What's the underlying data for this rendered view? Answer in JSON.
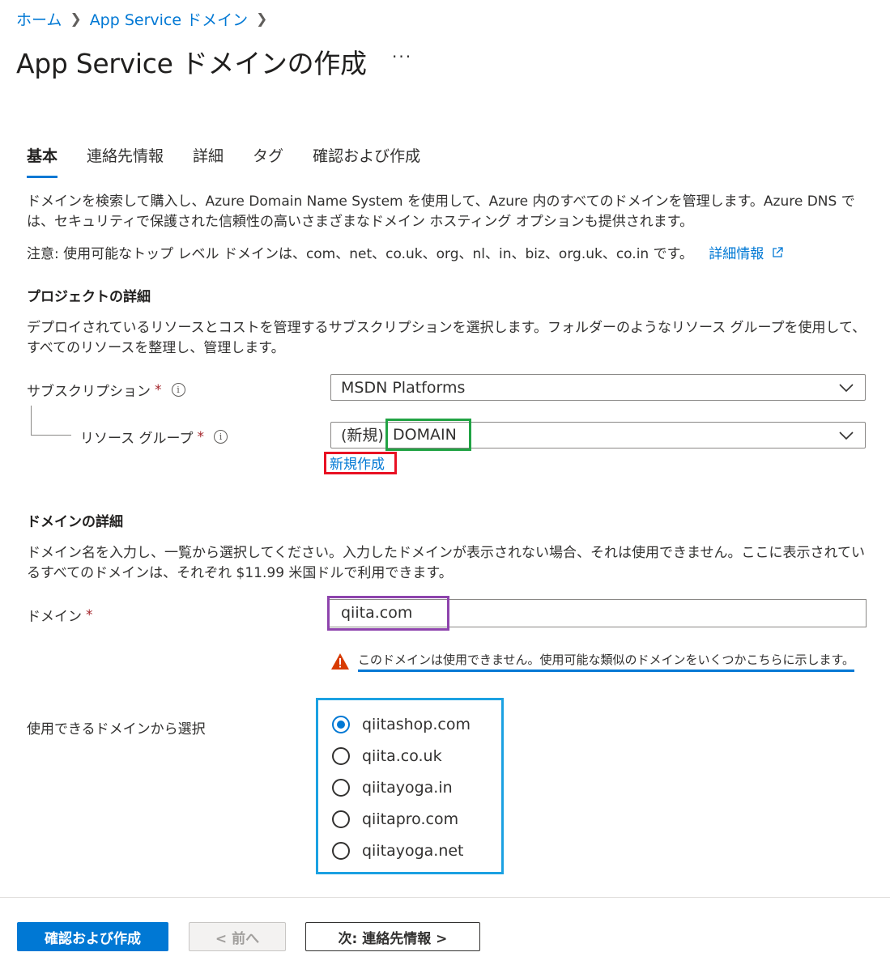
{
  "breadcrumb": {
    "home": "ホーム",
    "service": "App Service ドメイン"
  },
  "page": {
    "title": "App Service ドメインの作成",
    "more": "···"
  },
  "tabs": [
    {
      "label": "基本",
      "active": true
    },
    {
      "label": "連絡先情報"
    },
    {
      "label": "詳細"
    },
    {
      "label": "タグ"
    },
    {
      "label": "確認および作成"
    }
  ],
  "intro": {
    "description": "ドメインを検索して購入し、Azure Domain Name System を使用して、Azure 内のすべてのドメインを管理します。Azure DNS では、セキュリティで保護された信頼性の高いさまざまなドメイン ホスティング オプションも提供されます。",
    "note": "注意: 使用可能なトップ レベル ドメインは、com、net、co.uk、org、nl、in、biz、org.uk、co.in です。",
    "more_info_link": "詳細情報"
  },
  "project": {
    "heading": "プロジェクトの詳細",
    "description": "デプロイされているリソースとコストを管理するサブスクリプションを選択します。フォルダーのようなリソース グループを使用して、すべてのリソースを整理し、管理します。",
    "subscription_label": "サブスクリプション",
    "subscription_value": "MSDN Platforms",
    "resource_group_label": "リソース グループ",
    "resource_group_prefix": "(新規)",
    "resource_group_value": "DOMAIN",
    "create_new_link": "新規作成",
    "required_mark": "*"
  },
  "domain": {
    "heading": "ドメインの詳細",
    "description": "ドメイン名を入力し、一覧から選択してください。入力したドメインが表示されない場合、それは使用できません。ここに表示されているすべてのドメインは、それぞれ $11.99 米国ドルで利用できます。",
    "label": "ドメイン",
    "value": "qiita.com",
    "warning": "このドメインは使用できません。使用可能な類似のドメインをいくつかこちらに示します。",
    "choose_label": "使用できるドメインから選択",
    "options": [
      {
        "label": "qiitashop.com",
        "selected": true
      },
      {
        "label": "qiita.co.uk"
      },
      {
        "label": "qiitayoga.in"
      },
      {
        "label": "qiitapro.com"
      },
      {
        "label": "qiitayoga.net"
      }
    ]
  },
  "footer": {
    "review_create": "確認および作成",
    "previous": "< 前へ",
    "next": "次: 連絡先情報 >"
  },
  "colors": {
    "accent": "#0078d4",
    "required": "#a4262c",
    "warning": "#d83b01",
    "highlight_green": "#21a344",
    "highlight_red": "#e81123",
    "highlight_purple": "#8e44ad",
    "highlight_blue": "#1ba1e2"
  }
}
